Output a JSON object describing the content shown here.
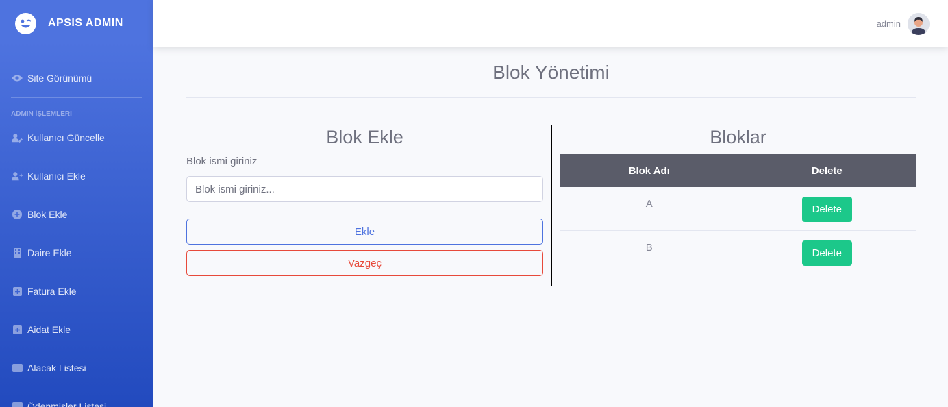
{
  "brand": {
    "title": "APSIS ADMIN"
  },
  "sidebar": {
    "site_view": {
      "label": "Site Görünümü",
      "icon": "eye-icon"
    },
    "heading": "ADMIN İŞLEMLERI",
    "items": [
      {
        "label": "Kullanıcı Güncelle",
        "icon": "user-edit-icon"
      },
      {
        "label": "Kullanıcı Ekle",
        "icon": "user-plus-icon"
      },
      {
        "label": "Blok Ekle",
        "icon": "plus-circle-icon"
      },
      {
        "label": "Daire Ekle",
        "icon": "building-icon"
      },
      {
        "label": "Fatura Ekle",
        "icon": "plus-square-icon"
      },
      {
        "label": "Aidat Ekle",
        "icon": "plus-square-icon"
      },
      {
        "label": "Alacak Listesi",
        "icon": "wallet-icon"
      },
      {
        "label": "Ödenmişler Listesi",
        "icon": "list-icon"
      }
    ]
  },
  "topbar": {
    "user_name": "admin"
  },
  "page": {
    "title": "Blok Yönetimi"
  },
  "form": {
    "title": "Blok Ekle",
    "label": "Blok ismi giriniz",
    "placeholder": "Blok ismi giriniz...",
    "value": "",
    "submit_label": "Ekle",
    "cancel_label": "Vazgeç"
  },
  "blocks": {
    "title": "Bloklar",
    "columns": [
      "Blok Adı",
      "Delete"
    ],
    "rows": [
      {
        "name": "A",
        "action": "Delete"
      },
      {
        "name": "B",
        "action": "Delete"
      }
    ]
  },
  "colors": {
    "sidebar_start": "#4e73df",
    "sidebar_end": "#224abe",
    "primary": "#4e73df",
    "danger": "#e74a3b",
    "success": "#1cc88a",
    "table_header": "#5a5c69"
  }
}
